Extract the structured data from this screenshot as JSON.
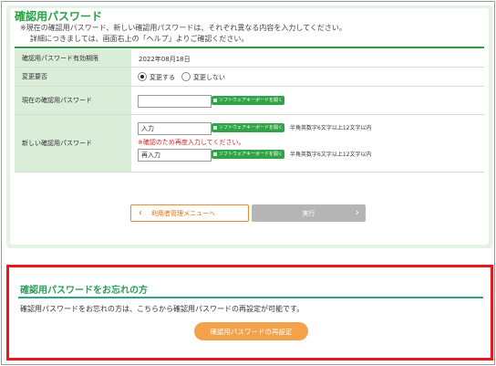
{
  "section": {
    "title": "確認用パスワード",
    "note_line1": "※現在の確認用パスワード、新しい確認用パスワードは、それぞれ異なる内容を入力してください。",
    "note_line2": "詳細につきましては、画面右上の「ヘルプ」よりご確認ください。"
  },
  "form": {
    "expiry": {
      "label": "確認用パスワード有効期限",
      "value": "2022年08月18日"
    },
    "change": {
      "label": "変更要否",
      "options": [
        "変更する",
        "変更しない"
      ],
      "selected": "変更する"
    },
    "current": {
      "label": "現在の確認用パスワード",
      "value": "",
      "keyboard_label": "ソフトウェアキーボードを開く"
    },
    "new": {
      "label": "新しい確認用パスワード",
      "input1": "入力",
      "input2": "再入力",
      "keyboard_label": "ソフトウェアキーボードを開く",
      "hint": "半角英数字6文字以上12文字以内",
      "confirm_note": "※確認のため再度入力してください。"
    }
  },
  "buttons": {
    "back": "利用者管理メニューへ",
    "execute": "実行"
  },
  "forgot": {
    "title": "確認用パスワードをお忘れの方",
    "text": "確認用パスワードをお忘れの方は、こちらから確認用パスワードの再設定が可能です。",
    "button": "確認用パスワードの再設定"
  },
  "colors": {
    "accent_green": "#28a042",
    "label_bg": "#d9edd9",
    "orange": "#f08a2a",
    "alert_red": "#e8181c"
  }
}
